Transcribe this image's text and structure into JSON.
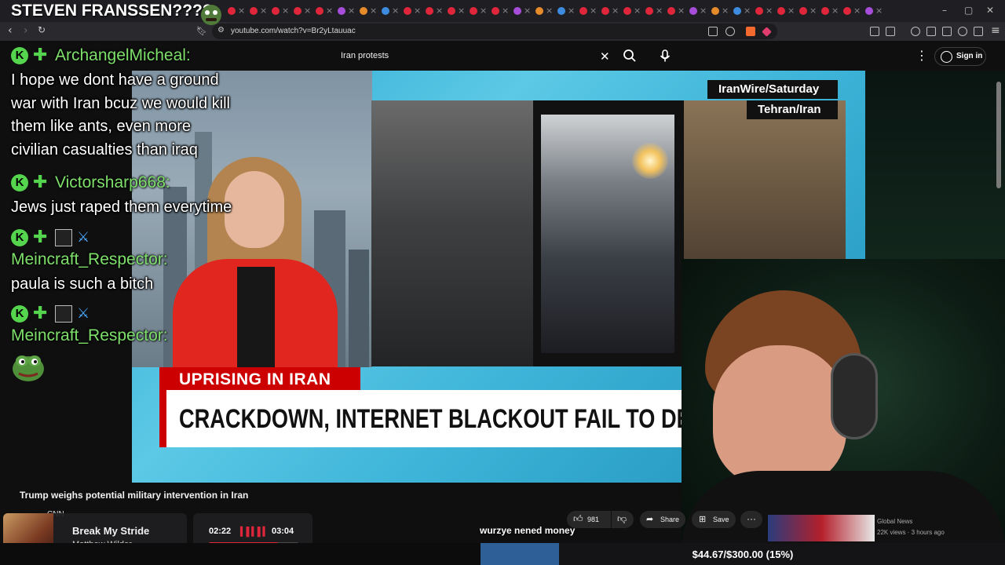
{
  "stream": {
    "title": "STEVEN FRANSSEN????"
  },
  "browser": {
    "url": "youtube.com/watch?v=Br2yLtauuac"
  },
  "youtube": {
    "search_query": "Iran protests",
    "sign_in": "Sign in"
  },
  "video": {
    "location_tag_1": "IranWire/Saturday",
    "location_tag_2": "Tehran/Iran",
    "banner_top": "UPRISING IN IRAN",
    "banner_main": "CRACKDOWN, INTERNET BLACKOUT FAIL TO DETER PROTEST",
    "title": "Trump weighs potential military intervention in Iran",
    "channel_stub": "CNN"
  },
  "chat": [
    {
      "user": "ArchangelMicheal:",
      "lines": [
        "I hope we dont have a ground",
        "war with Iran bcuz we would kill",
        "them like ants, even more",
        "civilian casualties than iraq"
      ]
    },
    {
      "user": "Victorsharp668:",
      "lines": [
        "Jews just raped them everytime"
      ]
    },
    {
      "user": "Meincraft_Respector:",
      "lines": [
        "paula is such a bitch"
      ]
    },
    {
      "user": "Meincraft_Respector:",
      "lines": []
    }
  ],
  "actions": {
    "likes": "981",
    "share": "Share",
    "save": "Save"
  },
  "recommended": {
    "channel": "Global News",
    "meta": "22K views · 3 hours ago"
  },
  "music": {
    "song": "Break My Stride",
    "artist": "Matthew Wilder",
    "elapsed": "02:22",
    "duration": "03:04",
    "progress": 0.77
  },
  "overlay_text": "wurzye nened money",
  "goal": {
    "text": "$44.67/$300.00 (15%)",
    "progress": 0.15
  },
  "colors": {
    "chat_name": "#7ee06b",
    "cnn_red": "#cc0000",
    "goal_fill": "#2e5f97",
    "player_accent": "#e0263a"
  }
}
